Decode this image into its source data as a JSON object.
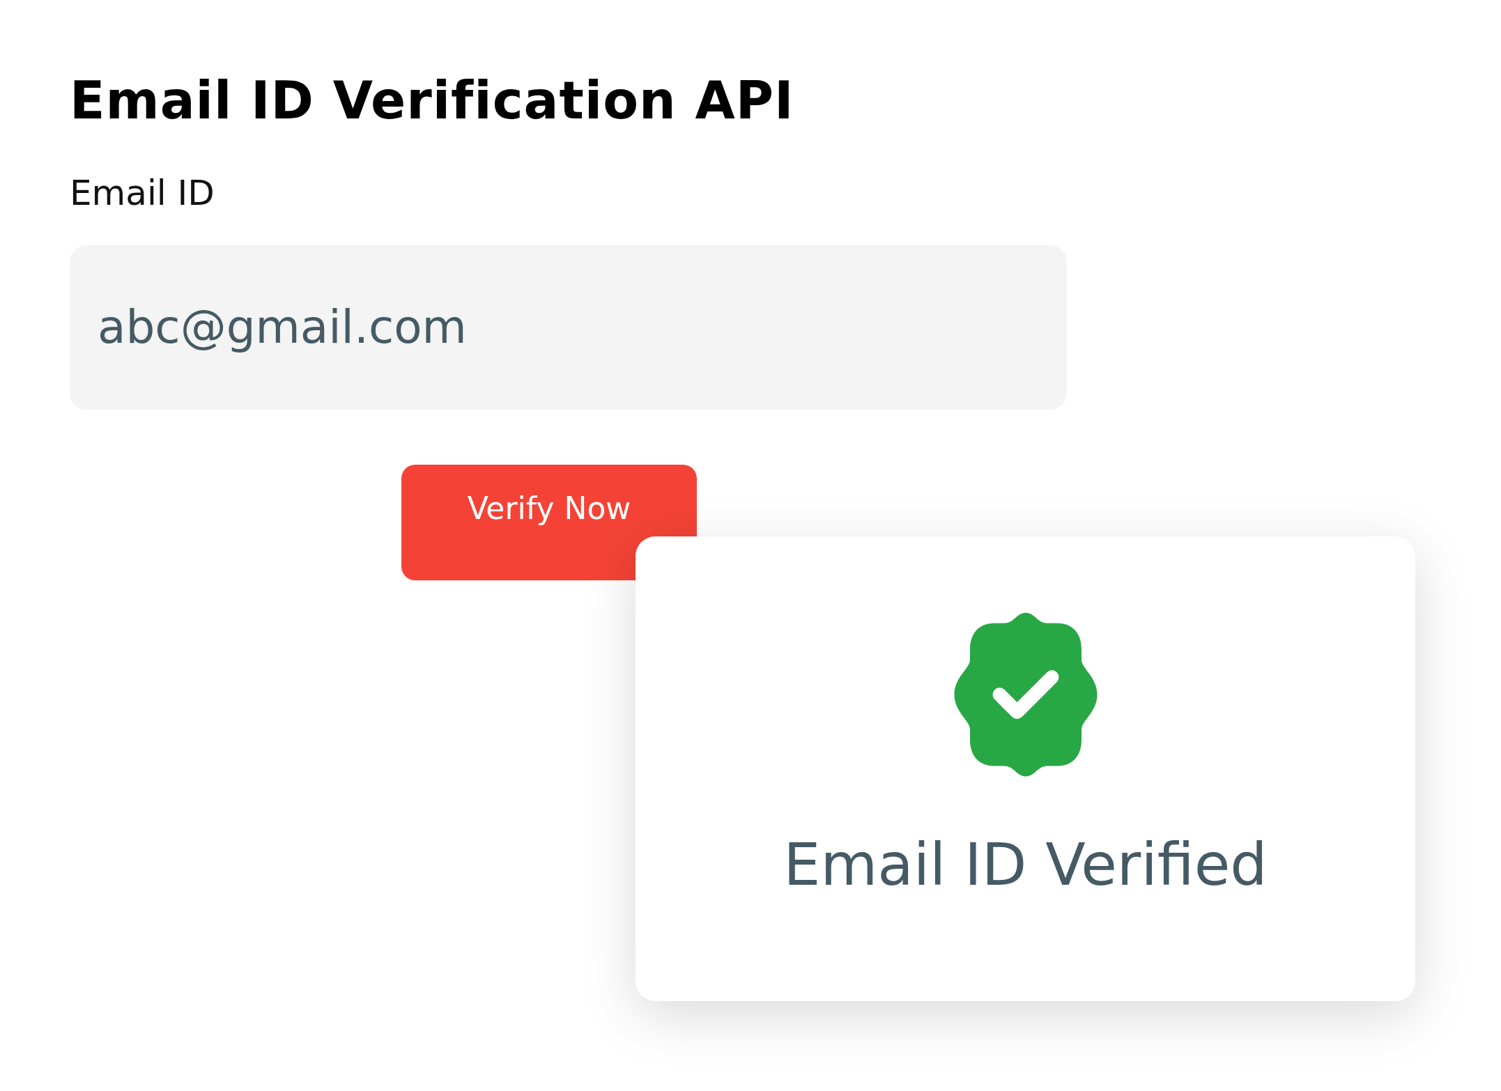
{
  "title": "Email ID Verification API",
  "field": {
    "label": "Email ID",
    "value": "abc@gmail.com"
  },
  "button": {
    "label": "Verify Now"
  },
  "result": {
    "verified": true,
    "message": "Email ID Verified"
  }
}
